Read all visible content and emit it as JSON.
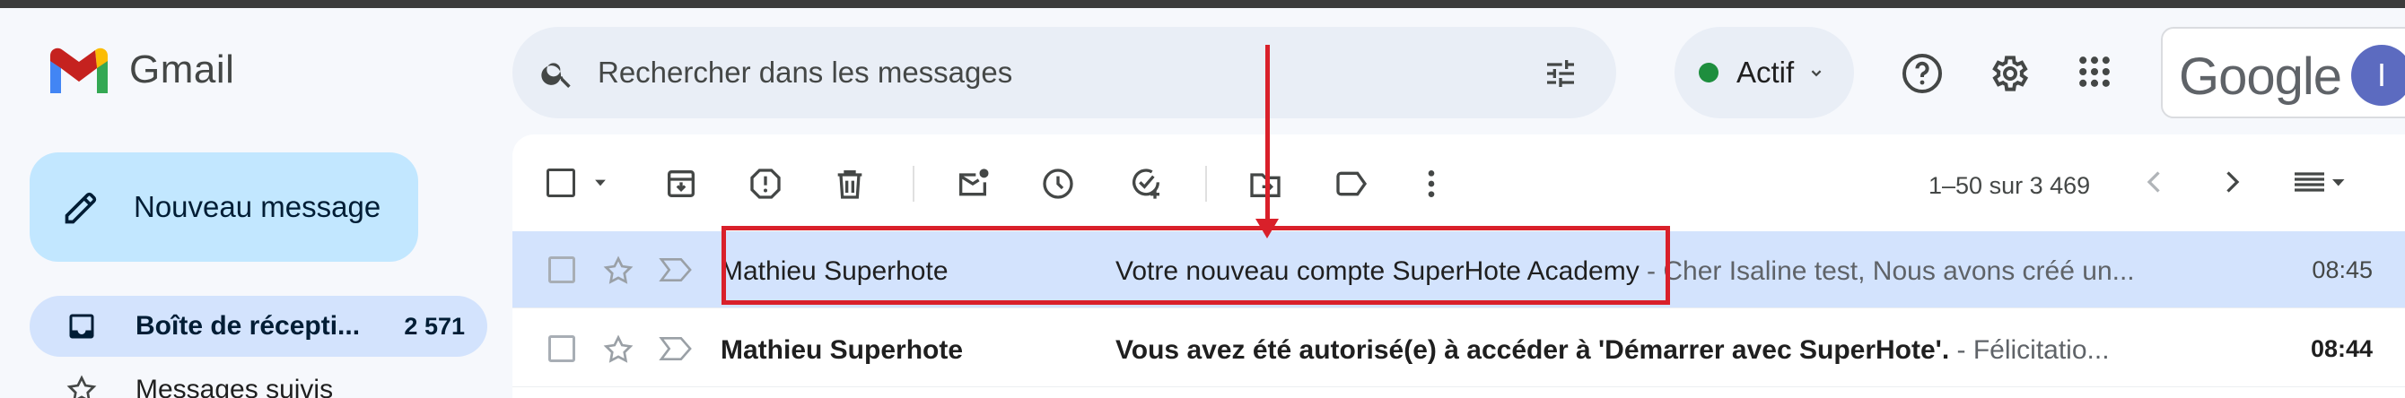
{
  "app": {
    "name": "Gmail"
  },
  "search": {
    "placeholder": "Rechercher dans les messages"
  },
  "status": {
    "label": "Actif",
    "color": "#1e8e3e"
  },
  "header": {
    "google_label": "Google",
    "avatar_initial": "I"
  },
  "compose": {
    "label": "Nouveau message"
  },
  "sidebar": {
    "items": [
      {
        "label": "Boîte de récepti...",
        "count": "2 571",
        "icon": "inbox-icon",
        "active": true
      },
      {
        "label": "Messages suivis",
        "icon": "star-icon",
        "active": false
      }
    ]
  },
  "toolbar": {
    "icons": [
      "select-checkbox",
      "select-dropdown",
      "archive-icon",
      "report-spam-icon",
      "delete-icon",
      "mark-unread-icon",
      "snooze-icon",
      "add-task-icon",
      "move-to-icon",
      "label-icon",
      "more-icon"
    ],
    "pagination": "1–50 sur 3 469"
  },
  "messages": [
    {
      "sender": "Mathieu Superhote",
      "subject": "Votre nouveau compte SuperHote Academy",
      "snippet": " - Cher Isaline test, Nous avons créé un...",
      "time": "08:45",
      "unread": false,
      "selected": true
    },
    {
      "sender": "Mathieu Superhote",
      "subject": "Vous avez été autorisé(e) à accéder à 'Démarrer avec SuperHote'.",
      "snippet": " - Félicitatio...",
      "time": "08:44",
      "unread": true,
      "selected": false
    }
  ],
  "colors": {
    "accent_red": "#d9202a",
    "selected_row": "#d3e3fd",
    "compose_bg": "#c2e7ff"
  }
}
